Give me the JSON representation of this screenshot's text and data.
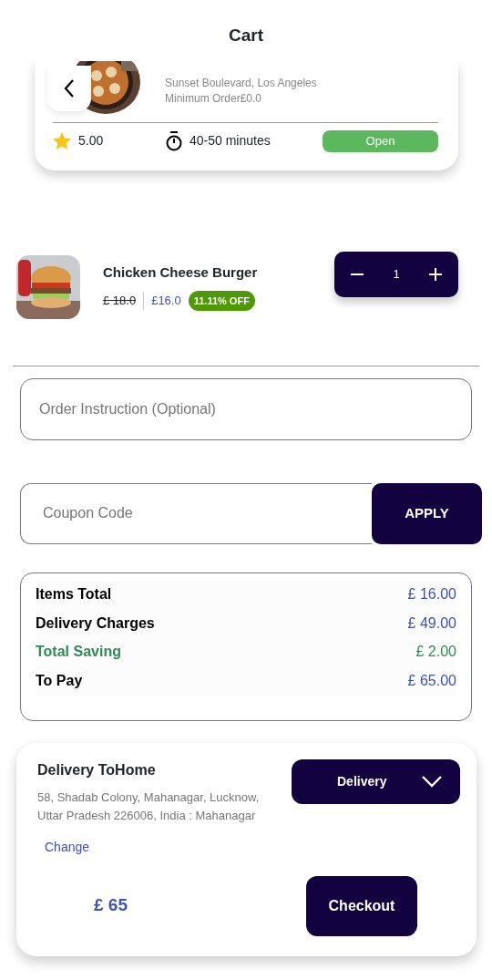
{
  "header": {
    "title": "Cart"
  },
  "restaurant": {
    "address": "Sunset Boulevard, Los Angeles",
    "minimum_order": "Minimum Order£0.0",
    "rating": "5.00",
    "delivery_time": "40-50 minutes",
    "status": "Open"
  },
  "cart_items": [
    {
      "name": "Chicken Cheese Burger",
      "old_price": "£ 18.0",
      "price": "£16.0",
      "discount": "11.11% OFF",
      "quantity": "1"
    }
  ],
  "instruction_field": {
    "placeholder": "Order Instruction (Optional)"
  },
  "coupon": {
    "placeholder": "Coupon Code",
    "button": "APPLY"
  },
  "summary": [
    {
      "label": "Items Total",
      "value": "£ 16.00",
      "kind": "normal"
    },
    {
      "label": "Delivery Charges",
      "value": "£ 49.00",
      "kind": "normal"
    },
    {
      "label": "Total Saving",
      "value": "£ 2.00",
      "kind": "saving"
    },
    {
      "label": "To Pay",
      "value": "£ 65.00",
      "kind": "normal"
    }
  ],
  "delivery": {
    "title": "Delivery ToHome",
    "address": "58, Shadab Colony, Mahanagar, Lucknow, Uttar Pradesh 226006, India : Mahanagar",
    "change": "Change",
    "mode": "Delivery",
    "total": "£ 65",
    "checkout": "Checkout"
  }
}
